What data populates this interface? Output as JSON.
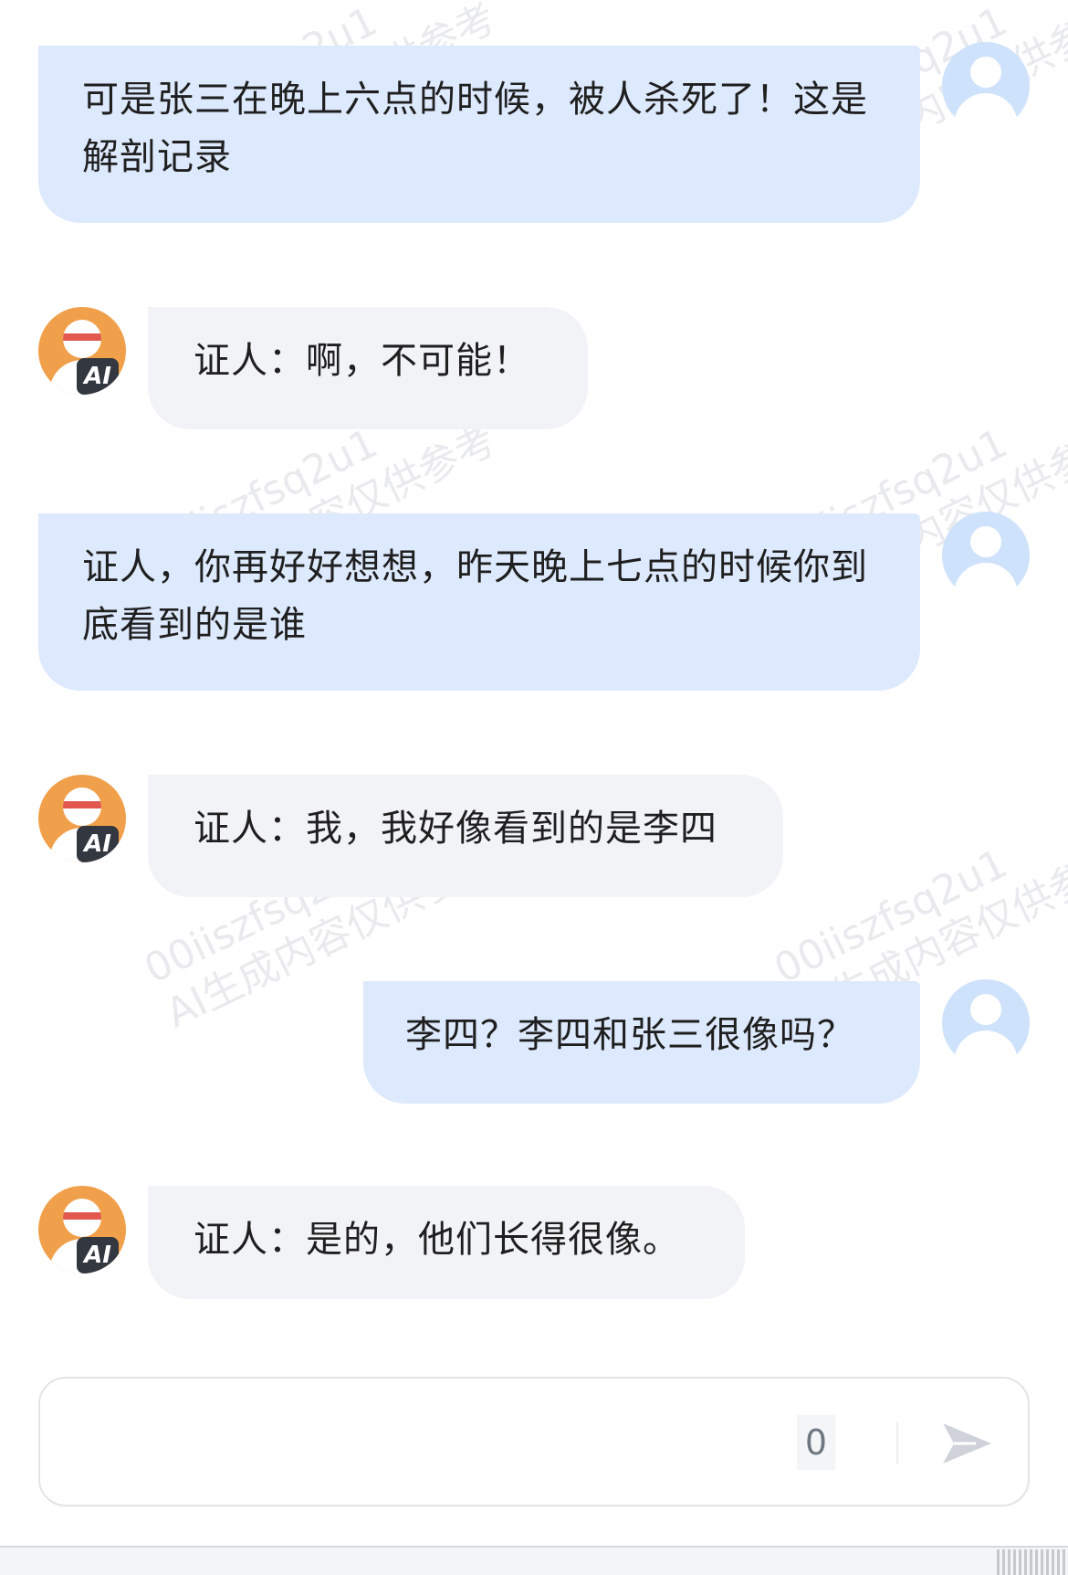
{
  "messages": [
    {
      "role": "user",
      "text": "可是张三在晚上六点的时候，被人杀死了！这是解剖记录",
      "avatar_icon": "user-avatar-icon"
    },
    {
      "role": "ai",
      "text": "证人：啊，不可能！",
      "avatar_icon": "ai-avatar-icon",
      "badge": "AI"
    },
    {
      "role": "user",
      "text": "证人，你再好好想想，昨天晚上七点的时候你到底看到的是谁",
      "avatar_icon": "user-avatar-icon"
    },
    {
      "role": "ai",
      "text": "证人：我，我好像看到的是李四",
      "avatar_icon": "ai-avatar-icon",
      "badge": "AI"
    },
    {
      "role": "user",
      "text": "李四？李四和张三很像吗？",
      "avatar_icon": "user-avatar-icon"
    },
    {
      "role": "ai",
      "text": "证人：是的，他们长得很像。",
      "avatar_icon": "ai-avatar-icon",
      "badge": "AI"
    }
  ],
  "watermark": {
    "line1": "00iiszfsq2u1",
    "line2": "AI生成内容仅供参考"
  },
  "input": {
    "value": "",
    "char_count": "0",
    "send_icon": "send-icon"
  },
  "colors": {
    "user_bubble": "#dde9fc",
    "ai_bubble": "#f1f3f6",
    "ai_avatar": "#f0a04a",
    "user_avatar": "#cfe2fb"
  }
}
